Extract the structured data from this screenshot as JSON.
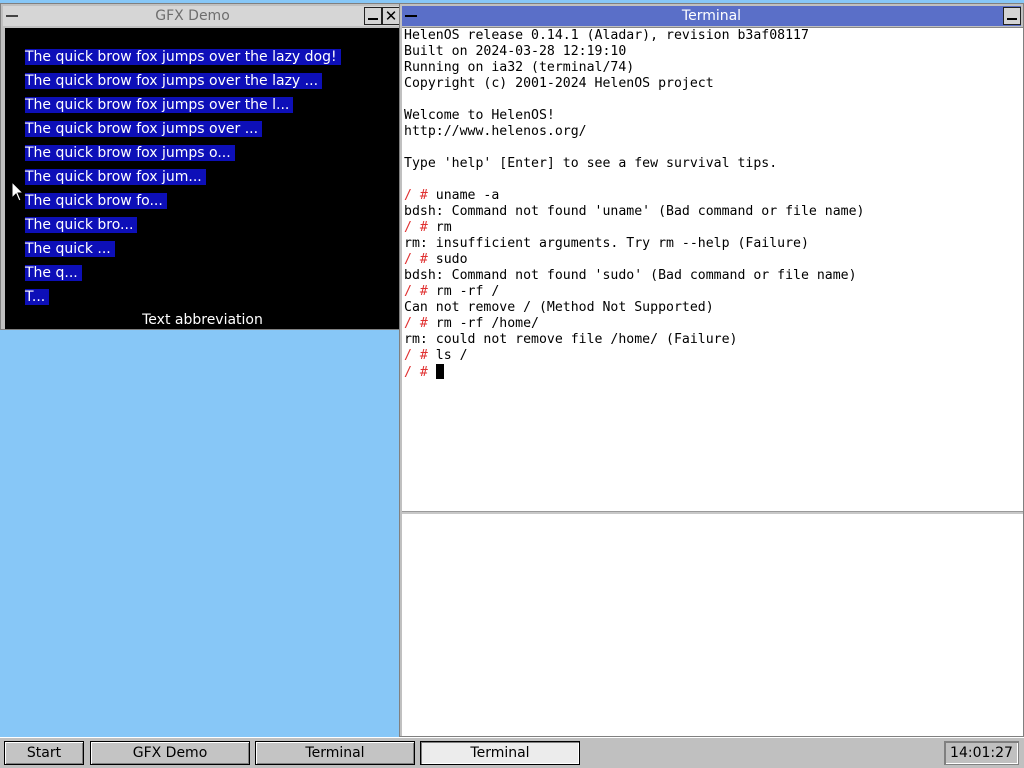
{
  "gfx_window": {
    "title": "GFX Demo",
    "lines": [
      "The quick brow fox jumps over the lazy dog!",
      "The quick brow fox jumps over the lazy ...",
      "The quick brow fox jumps over the l...",
      "The quick brow fox jumps over ...",
      "The quick brow fox jumps o...",
      "The quick brow fox jum...",
      "The quick brow fo...",
      "The quick bro...",
      "The quick ...",
      "The q...",
      "T..."
    ],
    "caption": "Text abbreviation",
    "colors": {
      "background": "#000000",
      "text_bg": "#0d0fb8",
      "text": "#ffffff"
    }
  },
  "terminal_window": {
    "title": "Terminal",
    "lines": [
      {
        "prompt": "",
        "text": "HelenOS release 0.14.1 (Aladar), revision b3af08117"
      },
      {
        "prompt": "",
        "text": "Built on 2024-03-28 12:19:10"
      },
      {
        "prompt": "",
        "text": "Running on ia32 (terminal/74)"
      },
      {
        "prompt": "",
        "text": "Copyright (c) 2001-2024 HelenOS project"
      },
      {
        "prompt": "",
        "text": ""
      },
      {
        "prompt": "",
        "text": "Welcome to HelenOS!"
      },
      {
        "prompt": "",
        "text": "http://www.helenos.org/"
      },
      {
        "prompt": "",
        "text": ""
      },
      {
        "prompt": "",
        "text": "Type 'help' [Enter] to see a few survival tips."
      },
      {
        "prompt": "",
        "text": ""
      },
      {
        "prompt": "/ # ",
        "text": "uname -a"
      },
      {
        "prompt": "",
        "text": "bdsh: Command not found 'uname' (Bad command or file name)"
      },
      {
        "prompt": "/ # ",
        "text": "rm"
      },
      {
        "prompt": "",
        "text": "rm: insufficient arguments. Try rm --help (Failure)"
      },
      {
        "prompt": "/ # ",
        "text": "sudo"
      },
      {
        "prompt": "",
        "text": "bdsh: Command not found 'sudo' (Bad command or file name)"
      },
      {
        "prompt": "/ # ",
        "text": "rm -rf /"
      },
      {
        "prompt": "",
        "text": "Can not remove / (Method Not Supported)"
      },
      {
        "prompt": "/ # ",
        "text": "rm -rf /home/"
      },
      {
        "prompt": "",
        "text": "rm: could not remove file /home/ (Failure)"
      },
      {
        "prompt": "/ # ",
        "text": "ls /"
      },
      {
        "prompt": "/ # ",
        "text": "",
        "cursor": true
      }
    ],
    "colors": {
      "title_bg": "#5a6fc8",
      "prompt": "#e03030"
    }
  },
  "taskbar": {
    "start_label": "Start",
    "tasks": [
      {
        "label": "GFX Demo",
        "pressed": false
      },
      {
        "label": "Terminal",
        "pressed": false
      },
      {
        "label": "Terminal",
        "pressed": true
      }
    ],
    "clock": "14:01:27"
  },
  "desktop": {
    "background": "#87c7f7"
  }
}
